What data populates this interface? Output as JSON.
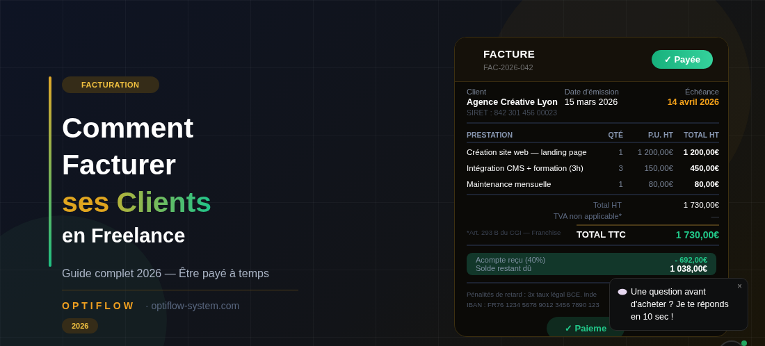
{
  "hero": {
    "category": "FACTURATION",
    "title_lines": [
      {
        "kind": "plain",
        "parts": [
          "Comment"
        ]
      },
      {
        "kind": "plain",
        "parts": [
          "Facturer"
        ]
      },
      {
        "kind": "accent",
        "parts": [
          "ses",
          "Clients"
        ]
      },
      {
        "kind": "small",
        "parts": [
          "en Freelance"
        ]
      }
    ],
    "subtitle": "Guide complet 2026 — Être payé à temps",
    "brand": "OPTIFLOW",
    "website": "· optiflow-system.com",
    "year": "2026"
  },
  "invoice": {
    "title": "FACTURE",
    "number": "FAC-2026-042",
    "status": {
      "label": "✓ Payée",
      "paid": true
    },
    "client": {
      "label": "Client",
      "name": "Agence Créative Lyon",
      "siret": "SIRET : 842 301 456 00023"
    },
    "issue_date": {
      "label": "Date d'émission",
      "value": "15 mars 2026"
    },
    "due_date": {
      "label": "Échéance",
      "value": "14 avril 2026"
    },
    "columns": [
      "PRESTATION",
      "QTÉ",
      "P.U. HT",
      "TOTAL HT"
    ],
    "rows": [
      {
        "description": "Création site web — landing page",
        "qty": "1",
        "unit_price": "1 200,00€",
        "total": "1 200,00€"
      },
      {
        "description": "Intégration CMS + formation (3h)",
        "qty": "3",
        "unit_price": "150,00€",
        "total": "450,00€"
      },
      {
        "description": "Maintenance mensuelle",
        "qty": "1",
        "unit_price": "80,00€",
        "total": "80,00€"
      }
    ],
    "subtotal": {
      "label": "Total HT",
      "value": "1 730,00€"
    },
    "vat": {
      "label": "TVA non applicable*",
      "value": "—"
    },
    "footnote": "*Art. 293 B du CGI — Franchise",
    "total": {
      "label": "TOTAL TTC",
      "value": "1 730,00€"
    },
    "deposit": {
      "label": "Acompte reçu (40%)",
      "value": "- 692,00€"
    },
    "balance": {
      "label": "Solde restant dû",
      "value": "1 038,00€"
    },
    "footer_lines": [
      "Pénalités de retard : 3x taux légal BCE. Inde",
      "IBAN : FR76 1234 5678 9012 3456 7890 123"
    ],
    "payment_button": "✓ Paieme"
  },
  "chat_popup": {
    "message": "Une question avant d'acheter ? Je te réponds en 10 sec !",
    "close": "×"
  }
}
